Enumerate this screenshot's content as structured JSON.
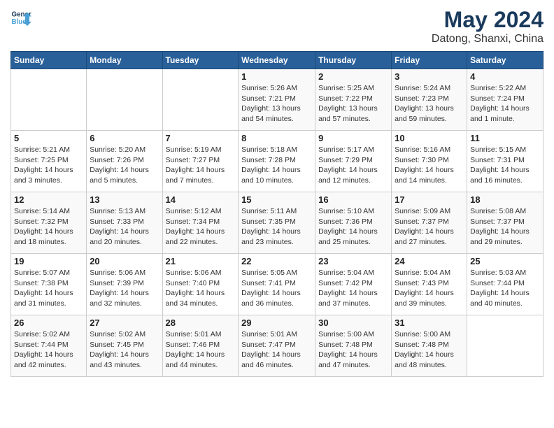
{
  "logo": {
    "line1": "General",
    "line2": "Blue"
  },
  "title": "May 2024",
  "subtitle": "Datong, Shanxi, China",
  "days_header": [
    "Sunday",
    "Monday",
    "Tuesday",
    "Wednesday",
    "Thursday",
    "Friday",
    "Saturday"
  ],
  "weeks": [
    [
      {
        "day": "",
        "info": ""
      },
      {
        "day": "",
        "info": ""
      },
      {
        "day": "",
        "info": ""
      },
      {
        "day": "1",
        "info": "Sunrise: 5:26 AM\nSunset: 7:21 PM\nDaylight: 13 hours\nand 54 minutes."
      },
      {
        "day": "2",
        "info": "Sunrise: 5:25 AM\nSunset: 7:22 PM\nDaylight: 13 hours\nand 57 minutes."
      },
      {
        "day": "3",
        "info": "Sunrise: 5:24 AM\nSunset: 7:23 PM\nDaylight: 13 hours\nand 59 minutes."
      },
      {
        "day": "4",
        "info": "Sunrise: 5:22 AM\nSunset: 7:24 PM\nDaylight: 14 hours\nand 1 minute."
      }
    ],
    [
      {
        "day": "5",
        "info": "Sunrise: 5:21 AM\nSunset: 7:25 PM\nDaylight: 14 hours\nand 3 minutes."
      },
      {
        "day": "6",
        "info": "Sunrise: 5:20 AM\nSunset: 7:26 PM\nDaylight: 14 hours\nand 5 minutes."
      },
      {
        "day": "7",
        "info": "Sunrise: 5:19 AM\nSunset: 7:27 PM\nDaylight: 14 hours\nand 7 minutes."
      },
      {
        "day": "8",
        "info": "Sunrise: 5:18 AM\nSunset: 7:28 PM\nDaylight: 14 hours\nand 10 minutes."
      },
      {
        "day": "9",
        "info": "Sunrise: 5:17 AM\nSunset: 7:29 PM\nDaylight: 14 hours\nand 12 minutes."
      },
      {
        "day": "10",
        "info": "Sunrise: 5:16 AM\nSunset: 7:30 PM\nDaylight: 14 hours\nand 14 minutes."
      },
      {
        "day": "11",
        "info": "Sunrise: 5:15 AM\nSunset: 7:31 PM\nDaylight: 14 hours\nand 16 minutes."
      }
    ],
    [
      {
        "day": "12",
        "info": "Sunrise: 5:14 AM\nSunset: 7:32 PM\nDaylight: 14 hours\nand 18 minutes."
      },
      {
        "day": "13",
        "info": "Sunrise: 5:13 AM\nSunset: 7:33 PM\nDaylight: 14 hours\nand 20 minutes."
      },
      {
        "day": "14",
        "info": "Sunrise: 5:12 AM\nSunset: 7:34 PM\nDaylight: 14 hours\nand 22 minutes."
      },
      {
        "day": "15",
        "info": "Sunrise: 5:11 AM\nSunset: 7:35 PM\nDaylight: 14 hours\nand 23 minutes."
      },
      {
        "day": "16",
        "info": "Sunrise: 5:10 AM\nSunset: 7:36 PM\nDaylight: 14 hours\nand 25 minutes."
      },
      {
        "day": "17",
        "info": "Sunrise: 5:09 AM\nSunset: 7:37 PM\nDaylight: 14 hours\nand 27 minutes."
      },
      {
        "day": "18",
        "info": "Sunrise: 5:08 AM\nSunset: 7:37 PM\nDaylight: 14 hours\nand 29 minutes."
      }
    ],
    [
      {
        "day": "19",
        "info": "Sunrise: 5:07 AM\nSunset: 7:38 PM\nDaylight: 14 hours\nand 31 minutes."
      },
      {
        "day": "20",
        "info": "Sunrise: 5:06 AM\nSunset: 7:39 PM\nDaylight: 14 hours\nand 32 minutes."
      },
      {
        "day": "21",
        "info": "Sunrise: 5:06 AM\nSunset: 7:40 PM\nDaylight: 14 hours\nand 34 minutes."
      },
      {
        "day": "22",
        "info": "Sunrise: 5:05 AM\nSunset: 7:41 PM\nDaylight: 14 hours\nand 36 minutes."
      },
      {
        "day": "23",
        "info": "Sunrise: 5:04 AM\nSunset: 7:42 PM\nDaylight: 14 hours\nand 37 minutes."
      },
      {
        "day": "24",
        "info": "Sunrise: 5:04 AM\nSunset: 7:43 PM\nDaylight: 14 hours\nand 39 minutes."
      },
      {
        "day": "25",
        "info": "Sunrise: 5:03 AM\nSunset: 7:44 PM\nDaylight: 14 hours\nand 40 minutes."
      }
    ],
    [
      {
        "day": "26",
        "info": "Sunrise: 5:02 AM\nSunset: 7:44 PM\nDaylight: 14 hours\nand 42 minutes."
      },
      {
        "day": "27",
        "info": "Sunrise: 5:02 AM\nSunset: 7:45 PM\nDaylight: 14 hours\nand 43 minutes."
      },
      {
        "day": "28",
        "info": "Sunrise: 5:01 AM\nSunset: 7:46 PM\nDaylight: 14 hours\nand 44 minutes."
      },
      {
        "day": "29",
        "info": "Sunrise: 5:01 AM\nSunset: 7:47 PM\nDaylight: 14 hours\nand 46 minutes."
      },
      {
        "day": "30",
        "info": "Sunrise: 5:00 AM\nSunset: 7:48 PM\nDaylight: 14 hours\nand 47 minutes."
      },
      {
        "day": "31",
        "info": "Sunrise: 5:00 AM\nSunset: 7:48 PM\nDaylight: 14 hours\nand 48 minutes."
      },
      {
        "day": "",
        "info": ""
      }
    ]
  ]
}
